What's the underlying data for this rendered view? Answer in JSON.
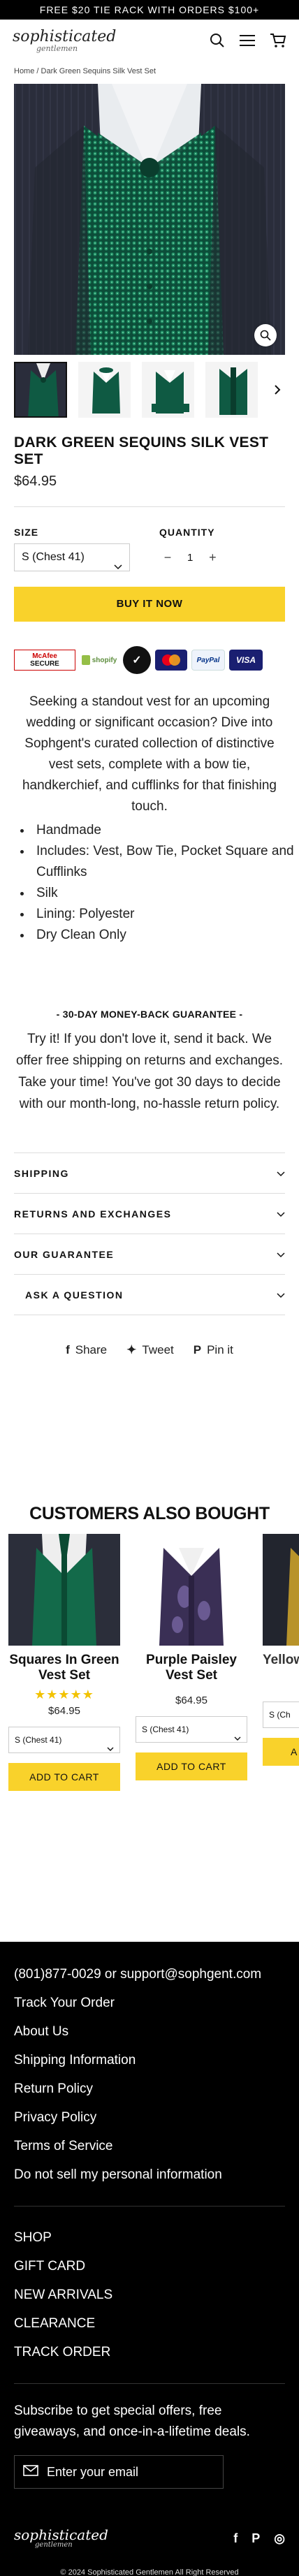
{
  "promo": {
    "text": "FREE $20 TIE RACK WITH ORDERS $100+"
  },
  "brand": {
    "logo_line1": "sophisticated",
    "logo_line2": "gentlemen"
  },
  "header": {
    "icons": [
      "search-icon",
      "menu-icon",
      "cart-icon"
    ]
  },
  "breadcrumb": {
    "home": "Home",
    "separator": "/",
    "current": "Dark Green Sequins Silk Vest Set"
  },
  "product": {
    "title": "DARK GREEN SEQUINS SILK VEST SET",
    "price": "$64.95",
    "size_label": "SIZE",
    "size_value": "S (Chest 41)",
    "qty_label": "QUANTITY",
    "qty_minus": "−",
    "qty_value": "1",
    "qty_plus": "+",
    "buy_now": "BUY IT NOW",
    "thumbnail_count": 4
  },
  "badges": {
    "mcafee_line1": "McAfee",
    "mcafee_line2": "SECURE",
    "shopify": "shopify",
    "mastercard": "mastercard",
    "paypal": "PayPal",
    "visa": "VISA"
  },
  "description": {
    "intro": "Seeking a standout vest for an upcoming wedding or significant occasion? Dive into Sophgent's curated collection of distinctive vest sets, complete with a bow tie, handkerchief, and cufflinks for that finishing touch.",
    "features": [
      "Handmade",
      "Includes: Vest, Bow Tie, Pocket Square and Cufflinks",
      "Silk",
      "Lining: Polyester",
      "Dry Clean Only"
    ]
  },
  "guarantee": {
    "title": "- 30-DAY MONEY-BACK GUARANTEE -",
    "body": "Try it! If you don't love it, send it back. We offer free shipping on returns and exchanges. Take your time! You've got 30 days to decide with our month-long, no-hassle return policy."
  },
  "accordion": [
    "SHIPPING",
    "RETURNS AND EXCHANGES",
    "OUR GUARANTEE",
    "ASK A QUESTION"
  ],
  "share": {
    "share": "Share",
    "tweet": "Tweet",
    "pin": "Pin it"
  },
  "also_bought": {
    "title": "CUSTOMERS ALSO BOUGHT",
    "cards": [
      {
        "name": "Squares In Green Vest Set",
        "stars": "★★★★★",
        "price": "$64.95",
        "size": "S (Chest 41)",
        "cta": "ADD TO CART"
      },
      {
        "name": "Purple Paisley Vest Set",
        "stars": "",
        "price": "$64.95",
        "size": "S (Chest 41)",
        "cta": "ADD TO CART"
      },
      {
        "name": "Yellow",
        "stars": "",
        "price": "",
        "size": "S (Ch",
        "cta": "A"
      }
    ]
  },
  "footer": {
    "contact": "(801)877-0029 or support@sophgent.com",
    "links": [
      "Track Your Order",
      "About Us",
      "Shipping Information",
      "Return Policy",
      "Privacy Policy",
      "Terms of Service",
      "Do not sell my personal information"
    ],
    "shop_links": [
      "SHOP",
      "GIFT CARD",
      "NEW ARRIVALS",
      "CLEARANCE",
      "TRACK ORDER"
    ],
    "subscribe": "Subscribe to get special offers, free giveaways, and once-in-a-lifetime deals.",
    "email_placeholder": "Enter your email",
    "social": {
      "facebook": "f",
      "pinterest": "P",
      "instagram": "◎"
    },
    "copyright": "© 2024 Sophisticated Gentlemen All Right Reserved"
  },
  "colors": {
    "accent": "#f9d22b",
    "footer_bg": "#000000",
    "vest_green": "#0f5a43"
  }
}
